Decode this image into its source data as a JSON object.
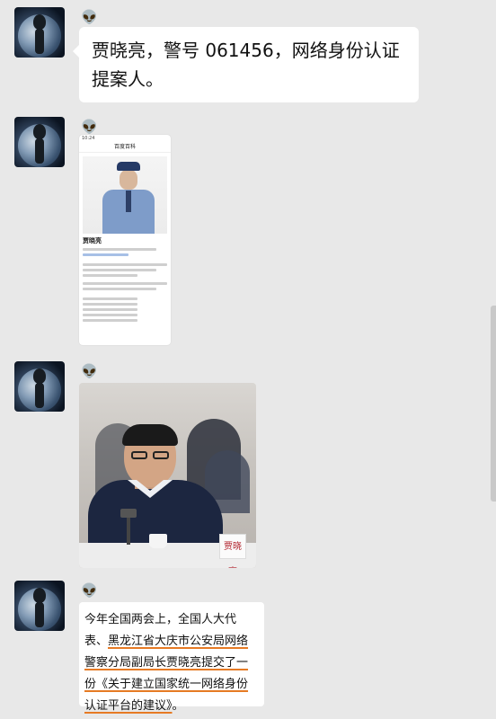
{
  "messages": [
    {
      "type": "text",
      "avatar_icon": "alien-avatar-icon",
      "emoji_icon": "alien-emoji",
      "text": "贾晓亮，警号 061456，网络身份认证提案人。"
    },
    {
      "type": "image",
      "description_icon": "encyclopedia-screenshot",
      "screenshot": {
        "status_time": "10:24",
        "page_title": "百度百科",
        "name": "贾晓亮"
      }
    },
    {
      "type": "image",
      "photo_sign": "贾晓亮"
    },
    {
      "type": "text",
      "text_parts": [
        "今年全国两会上，全国人大代表、",
        "黑龙江省大庆市公安局网络警察分局副局长贾晓亮提交了一份",
        "《关于建立国家统一网络身份认证平台的建议》",
        "。"
      ]
    }
  ],
  "colors": {
    "background": "#e8e8e8",
    "bubble": "#ffffff",
    "underline": "#e67a24",
    "sign_text": "#b0202a"
  }
}
